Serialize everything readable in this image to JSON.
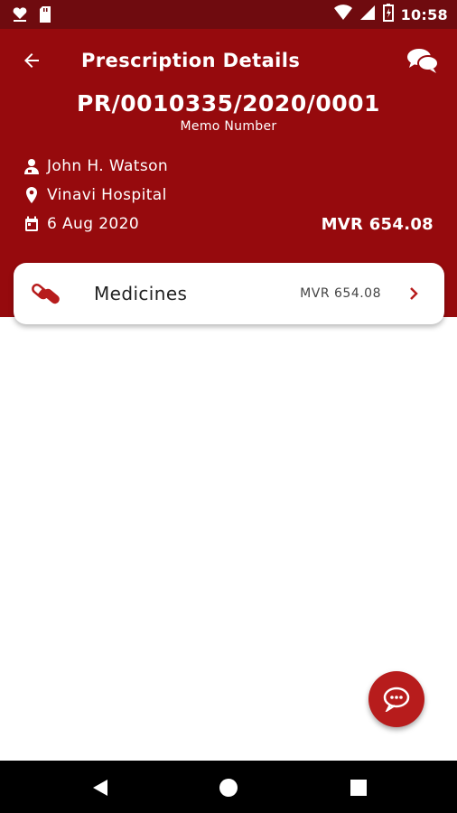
{
  "status_bar": {
    "time": "10:58"
  },
  "header": {
    "title": "Prescription Details",
    "memo_number": "PR/0010335/2020/0001",
    "memo_label": "Memo Number",
    "patient_name": "John H. Watson",
    "hospital": "Vinavi Hospital",
    "date": "6 Aug 2020",
    "total": "MVR 654.08"
  },
  "items": [
    {
      "label": "Medicines",
      "amount": "MVR 654.08",
      "icon": "pills-icon"
    }
  ],
  "colors": {
    "status_bar": "#6f0b0f",
    "header": "#960a0d",
    "accent": "#b71c1c"
  }
}
